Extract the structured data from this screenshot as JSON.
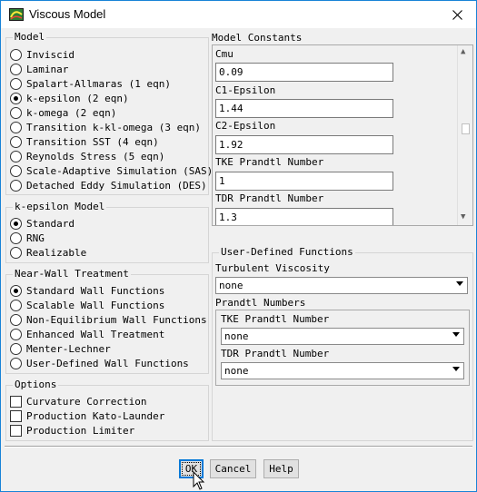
{
  "window": {
    "title": "Viscous Model",
    "app_icon": "fluent-app-icon",
    "close_icon": "close-icon"
  },
  "model": {
    "legend": "Model",
    "options": [
      {
        "label": "Inviscid",
        "selected": false
      },
      {
        "label": "Laminar",
        "selected": false
      },
      {
        "label": "Spalart-Allmaras (1 eqn)",
        "selected": false
      },
      {
        "label": "k-epsilon (2 eqn)",
        "selected": true
      },
      {
        "label": "k-omega (2 eqn)",
        "selected": false
      },
      {
        "label": "Transition k-kl-omega (3 eqn)",
        "selected": false
      },
      {
        "label": "Transition SST (4 eqn)",
        "selected": false
      },
      {
        "label": "Reynolds Stress (5 eqn)",
        "selected": false
      },
      {
        "label": "Scale-Adaptive Simulation (SAS)",
        "selected": false
      },
      {
        "label": "Detached Eddy Simulation (DES)",
        "selected": false
      }
    ]
  },
  "kepsilon_model": {
    "legend": "k-epsilon Model",
    "options": [
      {
        "label": "Standard",
        "selected": true
      },
      {
        "label": "RNG",
        "selected": false
      },
      {
        "label": "Realizable",
        "selected": false
      }
    ]
  },
  "near_wall": {
    "legend": "Near-Wall Treatment",
    "options": [
      {
        "label": "Standard Wall Functions",
        "selected": true
      },
      {
        "label": "Scalable Wall Functions",
        "selected": false
      },
      {
        "label": "Non-Equilibrium Wall Functions",
        "selected": false
      },
      {
        "label": "Enhanced Wall Treatment",
        "selected": false
      },
      {
        "label": "Menter-Lechner",
        "selected": false
      },
      {
        "label": "User-Defined Wall Functions",
        "selected": false
      }
    ]
  },
  "options": {
    "legend": "Options",
    "items": [
      {
        "label": "Curvature Correction",
        "checked": false
      },
      {
        "label": "Production Kato-Launder",
        "checked": false
      },
      {
        "label": "Production Limiter",
        "checked": false
      }
    ]
  },
  "model_constants": {
    "legend": "Model Constants",
    "items": [
      {
        "label": "Cmu",
        "value": "0.09"
      },
      {
        "label": "C1-Epsilon",
        "value": "1.44"
      },
      {
        "label": "C2-Epsilon",
        "value": "1.92"
      },
      {
        "label": "TKE Prandtl Number",
        "value": "1"
      },
      {
        "label": "TDR Prandtl Number",
        "value": "1.3"
      }
    ]
  },
  "udf": {
    "legend": "User-Defined Functions",
    "turbulent_viscosity_label": "Turbulent Viscosity",
    "turbulent_viscosity_value": "none",
    "prandtl_label": "Prandtl Numbers",
    "tke_label": "TKE Prandtl Number",
    "tke_value": "none",
    "tdr_label": "TDR Prandtl Number",
    "tdr_value": "none"
  },
  "buttons": {
    "ok": "OK",
    "cancel": "Cancel",
    "help": "Help"
  }
}
